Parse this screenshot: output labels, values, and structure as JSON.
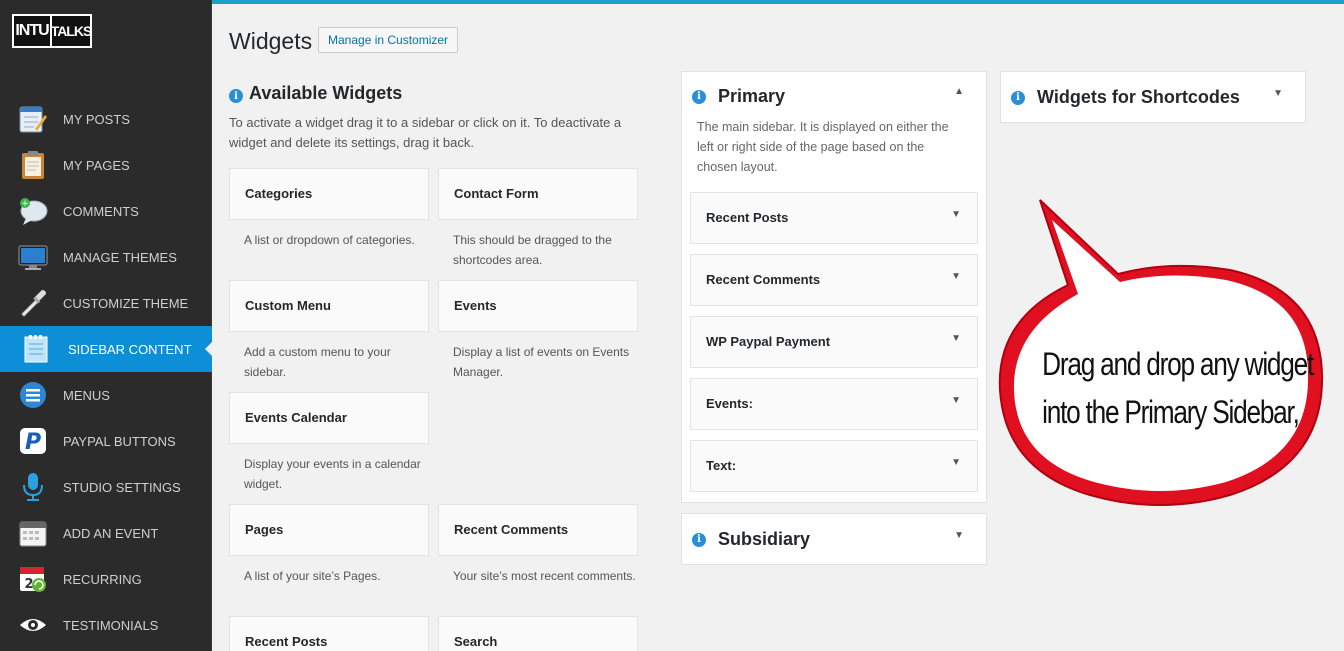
{
  "brand": {
    "logo_left": "INTU",
    "logo_right": "TALKS"
  },
  "sidebar": {
    "items": [
      {
        "label": "MY POSTS",
        "icon": "notepad-icon"
      },
      {
        "label": "MY PAGES",
        "icon": "clipboard-icon"
      },
      {
        "label": "COMMENTS",
        "icon": "speech-bubble-icon"
      },
      {
        "label": "MANAGE THEMES",
        "icon": "monitor-icon"
      },
      {
        "label": "CUSTOMIZE THEME",
        "icon": "eyedropper-icon"
      },
      {
        "label": "SIDEBAR CONTENT",
        "icon": "sidebar-doc-icon",
        "active": true
      },
      {
        "label": "MENUS",
        "icon": "menu-icon"
      },
      {
        "label": "PAYPAL BUTTONS",
        "icon": "paypal-icon"
      },
      {
        "label": "STUDIO SETTINGS",
        "icon": "microphone-icon"
      },
      {
        "label": "ADD AN EVENT",
        "icon": "calendar-icon"
      },
      {
        "label": "RECURRING",
        "icon": "recurring-calendar-icon"
      },
      {
        "label": "TESTIMONIALS",
        "icon": "eye-icon"
      }
    ]
  },
  "header": {
    "title": "Widgets",
    "customizer_button": "Manage in Customizer"
  },
  "available": {
    "title": "Available Widgets",
    "description": "To activate a widget drag it to a sidebar or click on it. To deactivate a widget and delete its settings, drag it back.",
    "widgets": [
      {
        "title": "Categories",
        "desc": "A list or dropdown of categories."
      },
      {
        "title": "Contact Form",
        "desc": "This should be dragged to the shortcodes area."
      },
      {
        "title": "Custom Menu",
        "desc": "Add a custom menu to your sidebar."
      },
      {
        "title": "Events",
        "desc": "Display a list of events on Events Manager."
      },
      {
        "title": "Events Calendar",
        "desc": "Display your events in a calendar widget."
      },
      {
        "title": "Pages",
        "desc": "A list of your site’s Pages."
      },
      {
        "title": "Recent Comments",
        "desc": "Your site’s most recent comments."
      },
      {
        "title": "Recent Posts",
        "desc": ""
      },
      {
        "title": "Search",
        "desc": ""
      }
    ]
  },
  "primary": {
    "title": "Primary",
    "description": "The main sidebar. It is displayed on either the left or right side of the page based on the chosen layout.",
    "widgets": [
      "Recent Posts",
      "Recent Comments",
      "WP Paypal Payment",
      "Events:",
      "Text:"
    ]
  },
  "subsidiary": {
    "title": "Subsidiary"
  },
  "shortcodes": {
    "title": "Widgets for Shortcodes"
  },
  "callout": {
    "line1": "Drag and drop any widget",
    "line2": "into the Primary Sidebar,"
  },
  "colors": {
    "accent": "#0d8fd8",
    "sidebar_bg": "#2b2b2b",
    "callout_red": "#e01020",
    "top_bar": "#1ba1cc"
  }
}
